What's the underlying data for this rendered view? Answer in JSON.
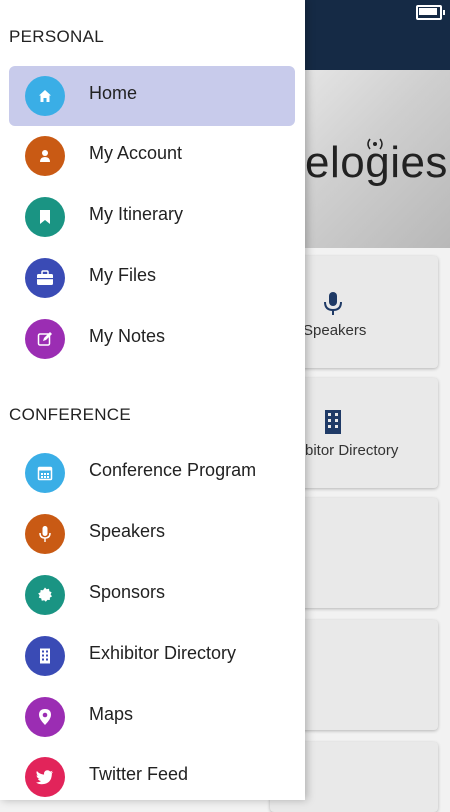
{
  "drawer": {
    "sections": [
      {
        "title": "PERSONAL"
      },
      {
        "title": "CONFERENCE"
      }
    ],
    "personal_items": [
      {
        "label": "Home",
        "icon": "home-icon",
        "color": "#3aaee6",
        "active": true
      },
      {
        "label": "My Account",
        "icon": "user-icon",
        "color": "#c95a14"
      },
      {
        "label": "My Itinerary",
        "icon": "bookmark-icon",
        "color": "#1a9483"
      },
      {
        "label": "My Files",
        "icon": "briefcase-icon",
        "color": "#3a4bb5"
      },
      {
        "label": "My Notes",
        "icon": "edit-icon",
        "color": "#9b2db3"
      }
    ],
    "conference_items": [
      {
        "label": "Conference Program",
        "icon": "calendar-icon",
        "color": "#3aaee6"
      },
      {
        "label": "Speakers",
        "icon": "microphone-icon",
        "color": "#c95a14"
      },
      {
        "label": "Sponsors",
        "icon": "badge-icon",
        "color": "#1a9483"
      },
      {
        "label": "Exhibitor Directory",
        "icon": "building-icon",
        "color": "#3a4bb5"
      },
      {
        "label": "Maps",
        "icon": "map-pin-icon",
        "color": "#9b2db3"
      },
      {
        "label": "Twitter Feed",
        "icon": "twitter-icon",
        "color": "#e2245a"
      }
    ]
  },
  "background": {
    "banner_text": "elogies",
    "cards": [
      {
        "label": "Speakers",
        "icon": "microphone-icon"
      },
      {
        "label": "bitor Directory",
        "icon": "building-icon"
      }
    ],
    "colors": {
      "topbar": "#152a45",
      "card_icon": "#1f3a66"
    }
  }
}
